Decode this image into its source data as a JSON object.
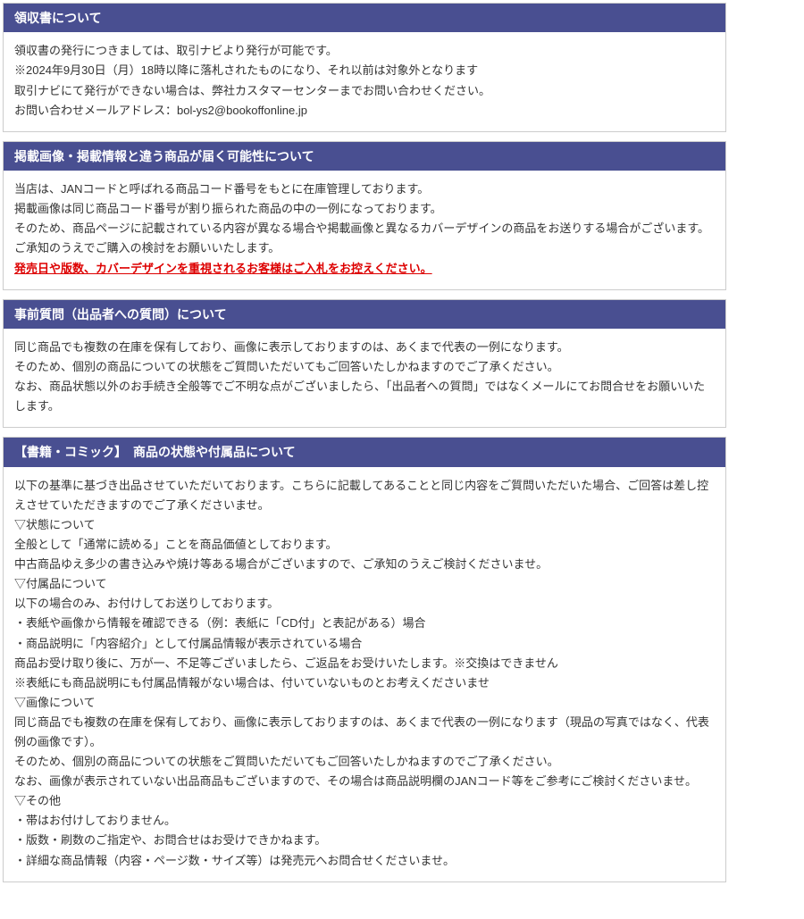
{
  "sections": [
    {
      "title": "領収書について",
      "paragraphs": [
        {
          "text": "領収書の発行につきましては、取引ナビより発行が可能です。"
        },
        {
          "text": "※2024年9月30日（月）18時以降に落札されたものになり、それ以前は対象外となります"
        },
        {
          "text": "取引ナビにて発行ができない場合は、弊社カスタマーセンターまでお問い合わせください。"
        },
        {
          "text": "お問い合わせメールアドレス：bol-ys2@bookoffonline.jp"
        }
      ]
    },
    {
      "title": "掲載画像・掲載情報と違う商品が届く可能性について",
      "paragraphs": [
        {
          "text": "当店は、JANコードと呼ばれる商品コード番号をもとに在庫管理しております。"
        },
        {
          "text": "掲載画像は同じ商品コード番号が割り振られた商品の中の一例になっております。"
        },
        {
          "text": "そのため、商品ページに記載されている内容が異なる場合や掲載画像と異なるカバーデザインの商品をお送りする場合がございます。"
        },
        {
          "text": "ご承知のうえでご購入の検討をお願いいたします。"
        },
        {
          "text": "発売日や版数、カバーデザインを重視されるお客様はご入札をお控えください。",
          "style": "red-underline"
        }
      ]
    },
    {
      "title": "事前質問（出品者への質問）について",
      "paragraphs": [
        {
          "text": "同じ商品でも複数の在庫を保有しており、画像に表示しておりますのは、あくまで代表の一例になります。"
        },
        {
          "text": "そのため、個別の商品についての状態をご質問いただいてもご回答いたしかねますのでご了承ください。"
        },
        {
          "text": "なお、商品状態以外のお手続き全般等でご不明な点がございましたら、「出品者への質問」ではなくメールにてお問合せをお願いいたします。"
        }
      ]
    },
    {
      "title": "【書籍・コミック】　商品の状態や付属品について",
      "paragraphs": [
        {
          "text": "以下の基準に基づき出品させていただいております。こちらに記載してあることと同じ内容をご質問いただいた場合、ご回答は差し控えさせていただきますのでご了承くださいませ。"
        },
        {
          "text": "▽状態について",
          "spaced": true
        },
        {
          "text": "全般として「通常に読める」ことを商品価値としております。"
        },
        {
          "text": "中古商品ゆえ多少の書き込みや焼け等ある場合がございますので、ご承知のうえご検討くださいませ。"
        },
        {
          "text": "▽付属品について",
          "spaced": true
        },
        {
          "text": "以下の場合のみ、お付けしてお送りしております。"
        },
        {
          "text": "・表紙や画像から情報を確認できる（例：表紙に「CD付」と表記がある）場合"
        },
        {
          "text": "・商品説明に「内容紹介」として付属品情報が表示されている場合"
        },
        {
          "text": "商品お受け取り後に、万が一、不足等ございましたら、ご返品をお受けいたします。※交換はできません"
        },
        {
          "text": "※表紙にも商品説明にも付属品情報がない場合は、付いていないものとお考えくださいませ"
        },
        {
          "text": "▽画像について",
          "spaced": true
        },
        {
          "text": "同じ商品でも複数の在庫を保有しており、画像に表示しておりますのは、あくまで代表の一例になります（現品の写真ではなく、代表例の画像です）。"
        },
        {
          "text": "そのため、個別の商品についての状態をご質問いただいてもご回答いたしかねますのでご了承ください。"
        },
        {
          "text": "なお、画像が表示されていない出品商品もございますので、その場合は商品説明欄のJANコード等をご参考にご検討くださいませ。"
        },
        {
          "text": "▽その他",
          "spaced": true
        },
        {
          "text": "・帯はお付けしておりません。"
        },
        {
          "text": "・版数・刷数のご指定や、お問合せはお受けできかねます。"
        },
        {
          "text": "・詳細な商品情報（内容・ページ数・サイズ等）は発売元へお問合せくださいませ。"
        }
      ]
    }
  ]
}
